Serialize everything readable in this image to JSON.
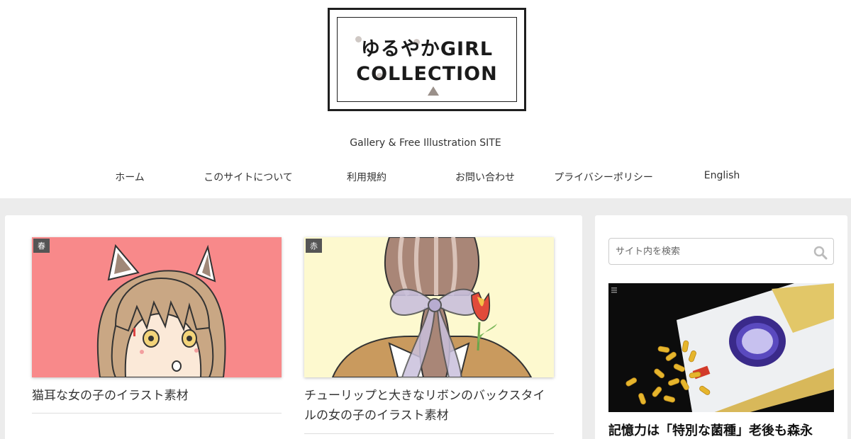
{
  "site": {
    "logo_line1": "ゆるやかGIRL",
    "logo_line2": "COLLECTION",
    "tagline": "Gallery & Free Illustration SITE"
  },
  "nav": {
    "items": [
      {
        "label": "ホーム"
      },
      {
        "label": "このサイトについて"
      },
      {
        "label": "利用規約"
      },
      {
        "label": "お問い合わせ"
      },
      {
        "label": "プライバシーポリシー"
      },
      {
        "label": "English"
      }
    ]
  },
  "posts": [
    {
      "category": "春",
      "title": "猫耳な女の子のイラスト素材",
      "thumb_bg": "#f8898a",
      "thumb_subject": "girl-with-cat-ears"
    },
    {
      "category": "赤",
      "title": "チューリップと大きなリボンのバックスタイルの女の子のイラスト素材",
      "thumb_bg": "#fdf9cf",
      "thumb_subject": "girl-back-with-ribbon-and-tulip"
    }
  ],
  "sidebar": {
    "search_placeholder": "サイト内を検索",
    "ad_headline": "記憶力は「特別な菌種」老後も森永"
  },
  "colors": {
    "page_bg": "#ececec",
    "card_bg": "#ffffff",
    "category_badge": "#555555",
    "logo_border": "#1f1f1f"
  },
  "icons": {
    "search": "search-icon",
    "menu": "menu-icon"
  }
}
